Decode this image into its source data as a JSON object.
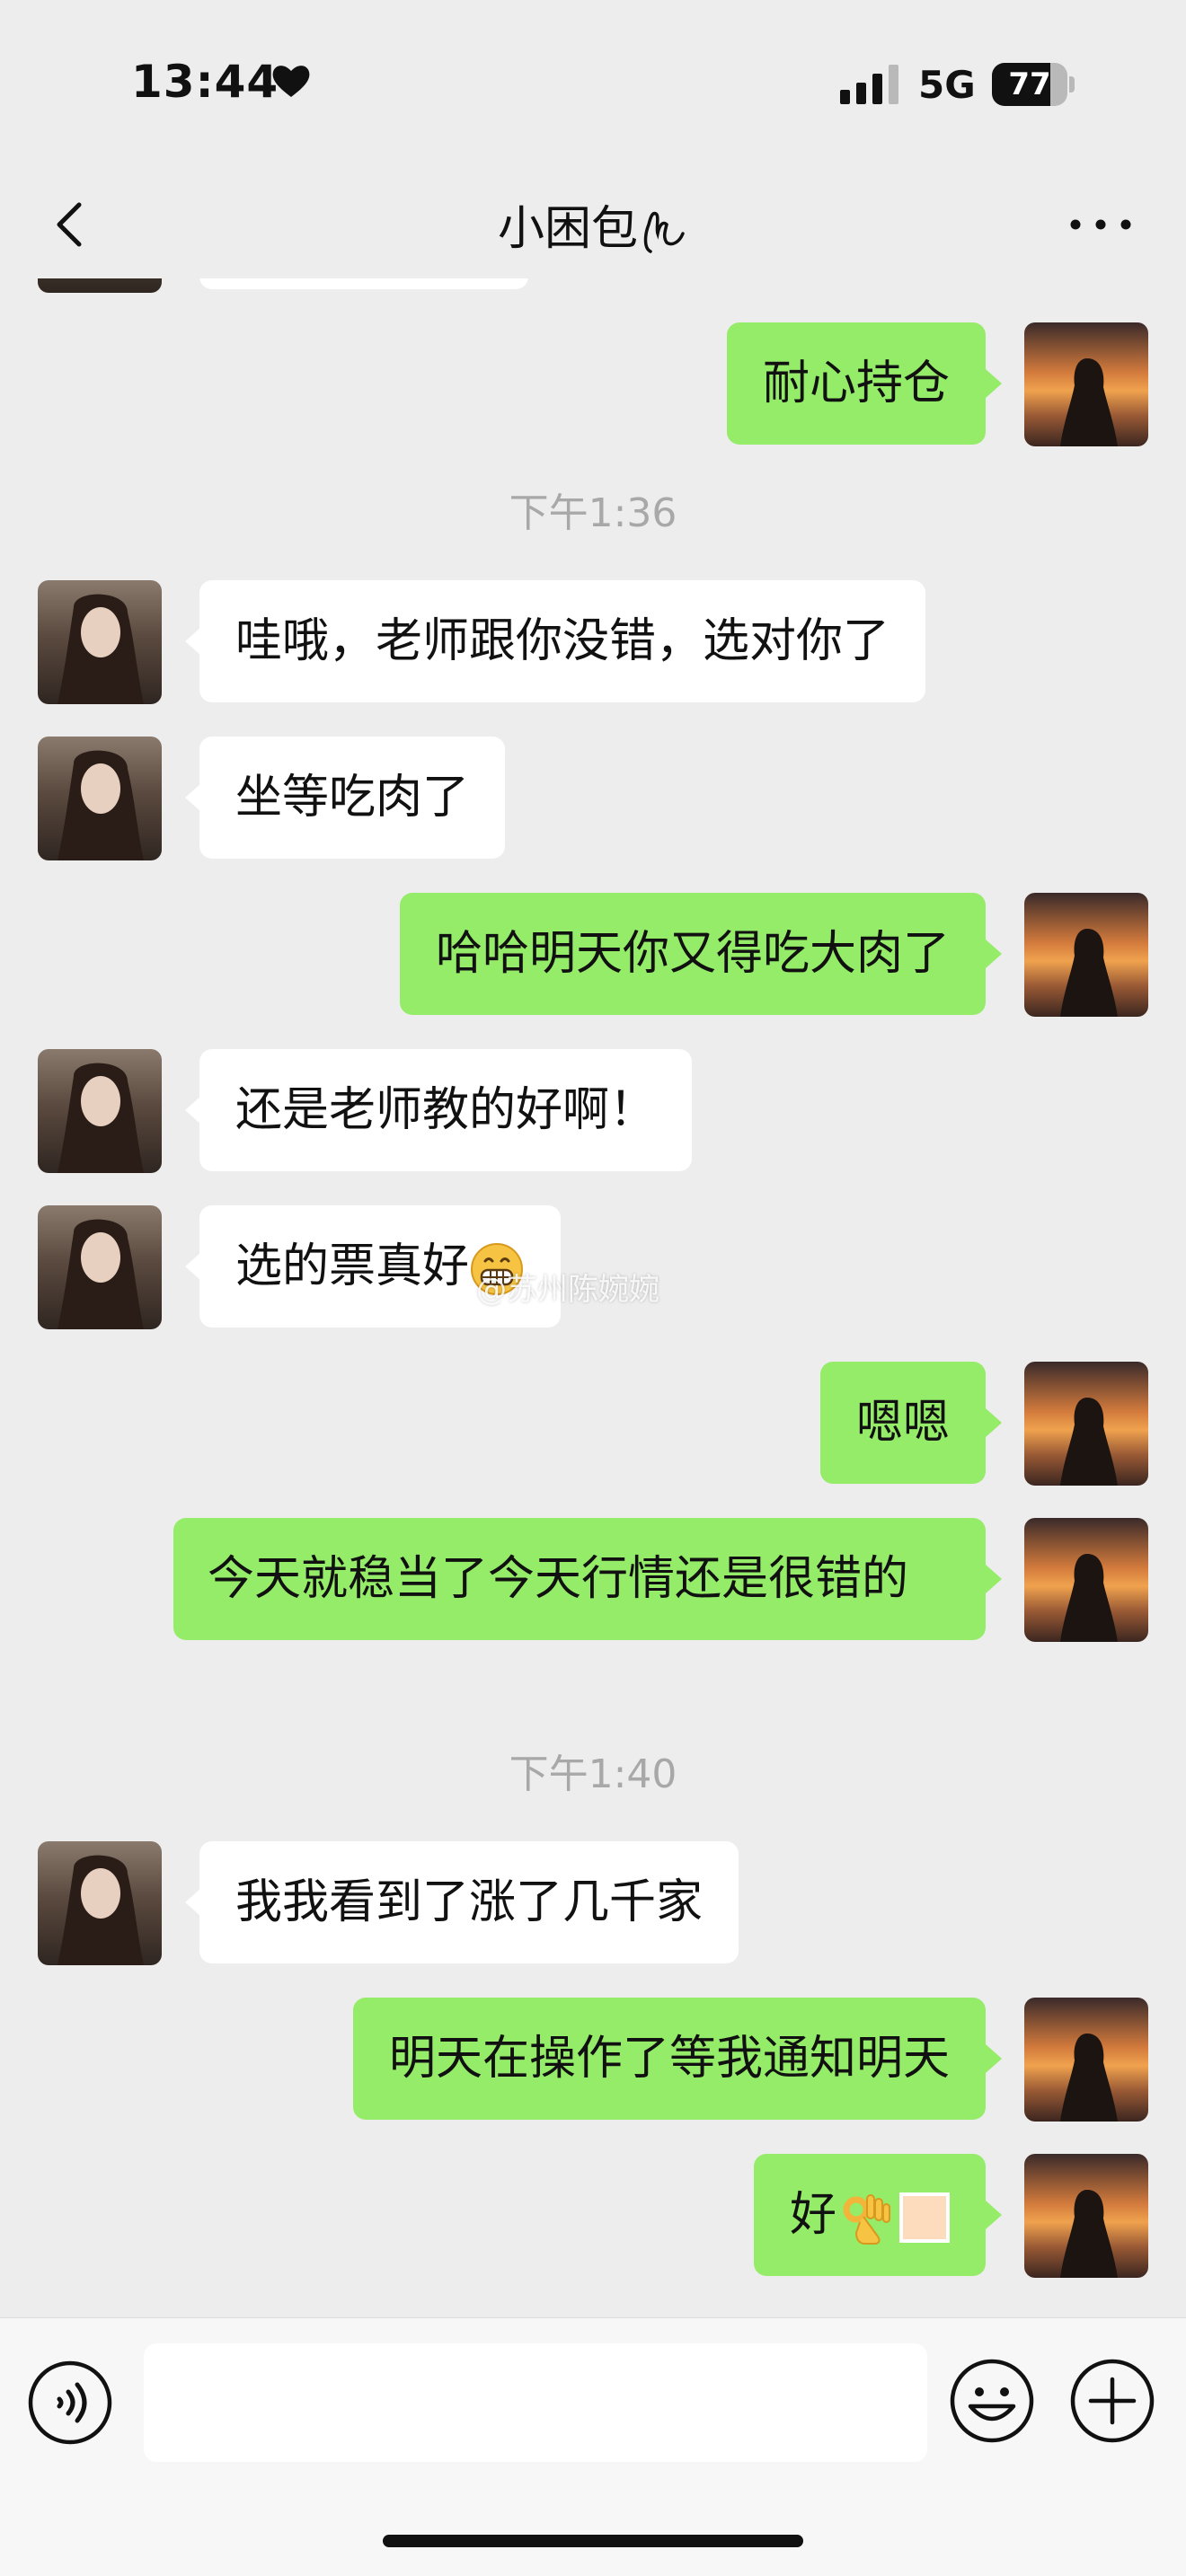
{
  "status_bar": {
    "time": "13:44",
    "network": "5G",
    "battery_percent": "77",
    "battery_level": 0.77
  },
  "header": {
    "title": "小困包"
  },
  "watermark": "@苏州陈婉婉",
  "messages": [
    {
      "side": "right",
      "text": "耐心持仓"
    },
    {
      "type": "time",
      "text": "下午1:36"
    },
    {
      "side": "left",
      "text": "哇哦，老师跟你没错，选对你了"
    },
    {
      "side": "left",
      "text": "坐等吃肉了"
    },
    {
      "side": "right",
      "text": "哈哈明天你又得吃大肉了"
    },
    {
      "side": "left",
      "text": "还是老师教的好啊！"
    },
    {
      "side": "left",
      "text": "选的票真好"
    },
    {
      "side": "right",
      "text": "嗯嗯"
    },
    {
      "side": "right",
      "text": "今天就稳当了今天行情还是很错的"
    },
    {
      "type": "time",
      "text": "下午1:40"
    },
    {
      "side": "left",
      "text": "我我看到了涨了几千家"
    },
    {
      "side": "right",
      "text": "明天在操作了等我通知明天"
    },
    {
      "side": "right",
      "text": "好"
    }
  ],
  "colors": {
    "background": "#ededed",
    "bubble_right": "#95ec69",
    "bubble_left": "#ffffff"
  },
  "icons": [
    "heart-icon",
    "signal-icon",
    "back-arrow-icon",
    "more-icon",
    "voice-icon",
    "emoji-icon",
    "plus-icon",
    "grin-emoji",
    "ok-hand-emoji"
  ]
}
